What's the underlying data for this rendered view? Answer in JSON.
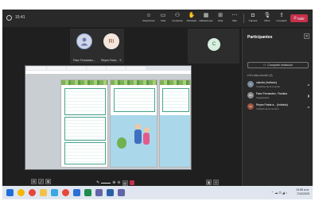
{
  "meeting": {
    "duration": "15:41",
    "leave_label": "Salir"
  },
  "toolbar": [
    {
      "name": "reactions",
      "label": "Reaccionar",
      "glyph": "☺"
    },
    {
      "name": "chat",
      "label": "Chat",
      "glyph": "▭"
    },
    {
      "name": "people",
      "label": "Contactos",
      "glyph": "⚇"
    },
    {
      "name": "raise-hand",
      "label": "Participar",
      "glyph": "✋"
    },
    {
      "name": "rooms",
      "label": "Habitaciones",
      "glyph": "▦"
    },
    {
      "name": "apps",
      "label": "Vista",
      "glyph": "⊞"
    },
    {
      "name": "more",
      "label": "Más",
      "glyph": "⋯"
    },
    {
      "name": "camera",
      "label": "Cámara",
      "glyph": "◘"
    },
    {
      "name": "mic",
      "label": "Micro",
      "glyph": "🎙"
    },
    {
      "name": "share",
      "label": "Compartir",
      "glyph": "⇪"
    }
  ],
  "tiles": [
    {
      "initials": "",
      "name": "Paez Fernandez..."
    },
    {
      "initials": "RI",
      "name": "Reyes Patric... ✎"
    },
    {
      "initials": "C",
      "name": ""
    }
  ],
  "presenter": "Paez Fernandez, Presentando",
  "panel": {
    "title": "Participantes",
    "invite_label": "Compartir invitación",
    "section": "En esta reunión (3)",
    "participants": [
      {
        "initials": "C",
        "name": "claudia (Invitado)",
        "role": "Invitados de la reunión",
        "color": "#7a8a9a"
      },
      {
        "initials": "PF",
        "name": "Paez Fernandez, Floralba",
        "role": "Organizador",
        "color": "#8c8c8c"
      },
      {
        "initials": "RI",
        "name": "Reyes Patria a... (Invitado)",
        "role": "Invitado de la reunión",
        "color": "#a0523d"
      }
    ]
  },
  "taskbar": {
    "time": "10:55 a.m.",
    "date": "7/10/2025"
  }
}
